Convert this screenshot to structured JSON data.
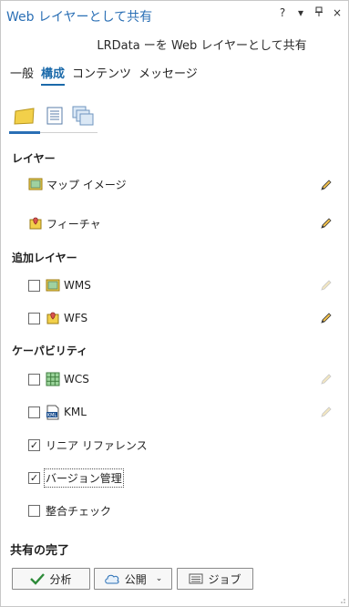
{
  "window": {
    "title": "Web レイヤーとして共有",
    "help_icon": "?",
    "menu_icon": "▾",
    "pin_icon": "pin",
    "close_icon": "×"
  },
  "subtitle": "LRData ーを Web レイヤーとして共有",
  "tabs": [
    {
      "label": "一般",
      "active": false
    },
    {
      "label": "構成",
      "active": true
    },
    {
      "label": "コンテンツ",
      "active": false
    },
    {
      "label": "メッセージ",
      "active": false
    }
  ],
  "subtabs": [
    "layers-icon",
    "properties-icon",
    "pages-icon"
  ],
  "sections": {
    "layers": "レイヤー",
    "additional_layers": "追加レイヤー",
    "capabilities": "ケーパビリティ"
  },
  "layers": [
    {
      "label": "マップ イメージ",
      "icon": "map-image-icon"
    },
    {
      "label": "フィーチャ",
      "icon": "feature-icon"
    }
  ],
  "additional_layers": [
    {
      "label": "WMS",
      "checked": false,
      "edit_enabled": false
    },
    {
      "label": "WFS",
      "checked": false,
      "edit_enabled": true
    }
  ],
  "capabilities": [
    {
      "label": "WCS",
      "checked": false,
      "edit_enabled": false
    },
    {
      "label": "KML",
      "checked": false,
      "edit_enabled": false
    },
    {
      "label": "リニア リファレンス",
      "checked": true
    },
    {
      "label": "バージョン管理",
      "checked": true
    },
    {
      "label": "整合チェック",
      "checked": false
    }
  ],
  "finish": {
    "title": "共有の完了",
    "analyze_label": "分析",
    "publish_label": "公開",
    "jobs_label": "ジョブ"
  },
  "colors": {
    "accent": "#1b6aaa",
    "title": "#2a6fb5",
    "pencil_enabled": "#3a3a3a",
    "pencil_disabled": "#c8c8c8",
    "folder": "#f2d04a",
    "check_green": "#2e8b3a"
  }
}
